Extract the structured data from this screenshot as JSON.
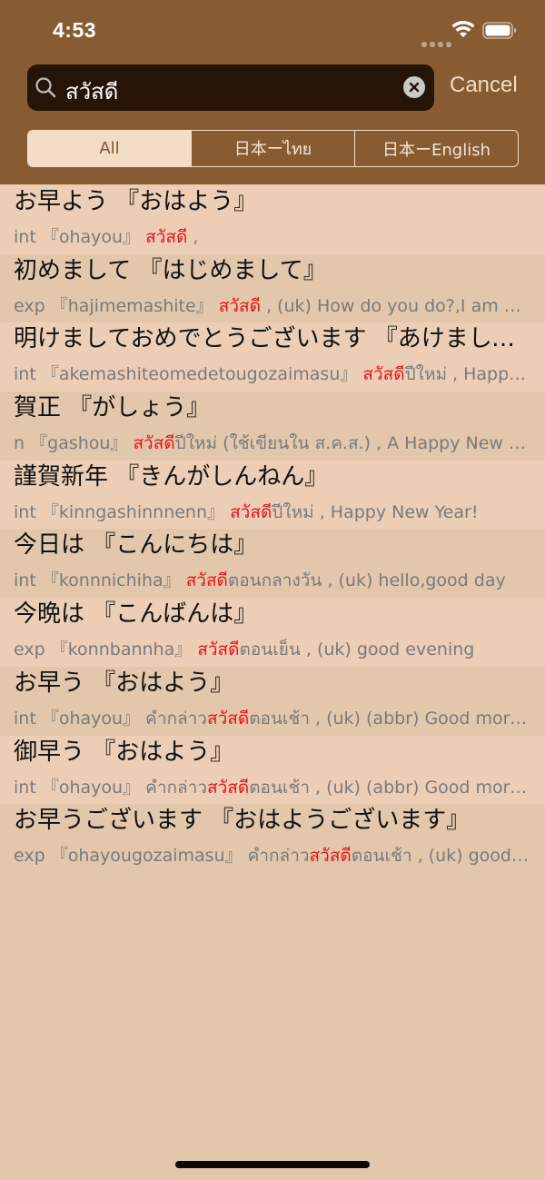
{
  "status_bar": {
    "time": "4:53"
  },
  "search": {
    "query": "สวัสดี",
    "cancel_label": "Cancel"
  },
  "tabs": [
    {
      "label": "All",
      "selected": true
    },
    {
      "label": "日本ーไทย",
      "selected": false
    },
    {
      "label": "日本ーEnglish",
      "selected": false
    }
  ],
  "results": [
    {
      "headword": "お早よう 『おはよう』",
      "pos": "int",
      "reading": "『ohayou』",
      "pre": "",
      "highlight": "สวัสดี",
      "post": " ,",
      "shade": "light"
    },
    {
      "headword": "初めまして 『はじめまして』",
      "pos": "exp",
      "reading": "『hajimemashite』",
      "pre": "",
      "highlight": "สวัสดี",
      "post": " , (uk) How do you do?,I am glad to meet you",
      "shade": "dark"
    },
    {
      "headword": "明けましておめでとうございます 『あけましておめでとうございます』",
      "pos": "int",
      "reading": "『akemashiteomedetougozaimasu』",
      "pre": "",
      "highlight": "สวัสดี",
      "post": "ปีใหม่ , Happy New Year",
      "shade": "light"
    },
    {
      "headword": "賀正 『がしょう』",
      "pos": "n",
      "reading": "『gashou』",
      "pre": "",
      "highlight": "สวัสดี",
      "post": "ปีใหม่ (ใช้เขียนใน ส.ค.ส.) , A Happy New Year",
      "shade": "dark"
    },
    {
      "headword": "謹賀新年 『きんがしんねん』",
      "pos": "int",
      "reading": "『kinngashinnnenn』",
      "pre": "",
      "highlight": "สวัสดี",
      "post": "ปีใหม่ , Happy New Year!",
      "shade": "light"
    },
    {
      "headword": "今日は 『こんにちは』",
      "pos": "int",
      "reading": "『konnnichiha』",
      "pre": "",
      "highlight": "สวัสดี",
      "post": "ตอนกลางวัน , (uk) hello,good day",
      "shade": "dark"
    },
    {
      "headword": "今晩は 『こんばんは』",
      "pos": "exp",
      "reading": "『konnbannha』",
      "pre": "",
      "highlight": "สวัสดี",
      "post": "ตอนเย็น , (uk) good evening",
      "shade": "light"
    },
    {
      "headword": "お早う 『おはよう』",
      "pos": "int",
      "reading": "『ohayou』",
      "pre": "คำกล่าว",
      "highlight": "สวัสดี",
      "post": "ตอนเช้า , (uk) (abbr) Good morning",
      "shade": "dark"
    },
    {
      "headword": "御早う 『おはよう』",
      "pos": "int",
      "reading": "『ohayou』",
      "pre": "คำกล่าว",
      "highlight": "สวัสดี",
      "post": "ตอนเช้า , (uk) (abbr) Good morning",
      "shade": "light"
    },
    {
      "headword": "お早うございます 『おはようございます』",
      "pos": "exp",
      "reading": "『ohayougozaimasu』",
      "pre": "คำกล่าว",
      "highlight": "สวัสดี",
      "post": "ตอนเช้า , (uk) good morning",
      "shade": "dark"
    }
  ],
  "colors": {
    "header_bg": "#875c33",
    "list_bg": "#e3c7ac",
    "row_light": "#ecceb6",
    "highlight": "#e8141a",
    "search_bg": "#261409"
  },
  "icons": [
    "signal-dots-icon",
    "wifi-icon",
    "battery-icon",
    "search-icon",
    "clear-icon"
  ]
}
